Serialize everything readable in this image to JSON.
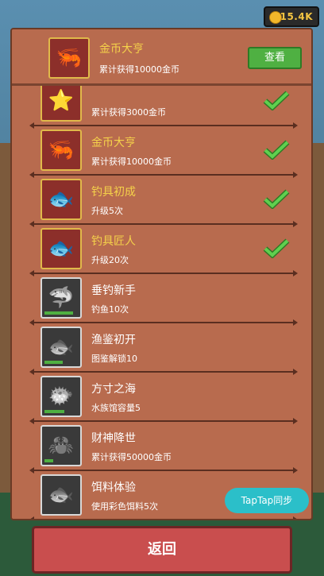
{
  "currency": {
    "coins": "15.4K",
    "icon": "gold-coin-icon",
    "color": "#f4c542"
  },
  "header": {
    "title": "金币大亨",
    "desc": "累计获得10000金币",
    "view_label": "查看",
    "icon": "shrimp-icon"
  },
  "achievements": [
    {
      "title": "",
      "desc": "累计获得3000金币",
      "icon": "starfish-icon",
      "done": true,
      "progress": 1.0
    },
    {
      "title": "金币大亨",
      "desc": "累计获得10000金币",
      "icon": "shrimp-icon",
      "done": true,
      "progress": 1.0
    },
    {
      "title": "钓具初成",
      "desc": "升级5次",
      "icon": "fish-icon",
      "done": true,
      "progress": 1.0
    },
    {
      "title": "钓具匠人",
      "desc": "升级20次",
      "icon": "fish-icon",
      "done": true,
      "progress": 1.0
    },
    {
      "title": "垂钓新手",
      "desc": "钓鱼10次",
      "icon": "shark-icon",
      "done": false,
      "progress": 0.85
    },
    {
      "title": "渔鉴初开",
      "desc": "图鉴解锁10",
      "icon": "fish-icon",
      "done": false,
      "progress": 0.55
    },
    {
      "title": "方寸之海",
      "desc": "水族馆容量5",
      "icon": "pufferfish-icon",
      "done": false,
      "progress": 0.6
    },
    {
      "title": "财神降世",
      "desc": "累计获得50000金币",
      "icon": "crab-icon",
      "done": false,
      "progress": 0.25
    },
    {
      "title": "饵料体验",
      "desc": "使用彩色饵料5次",
      "icon": "fish-skeleton-icon",
      "done": false,
      "progress": 0.0
    }
  ],
  "taptap_label": "TapTap同步",
  "back_label": "返回"
}
